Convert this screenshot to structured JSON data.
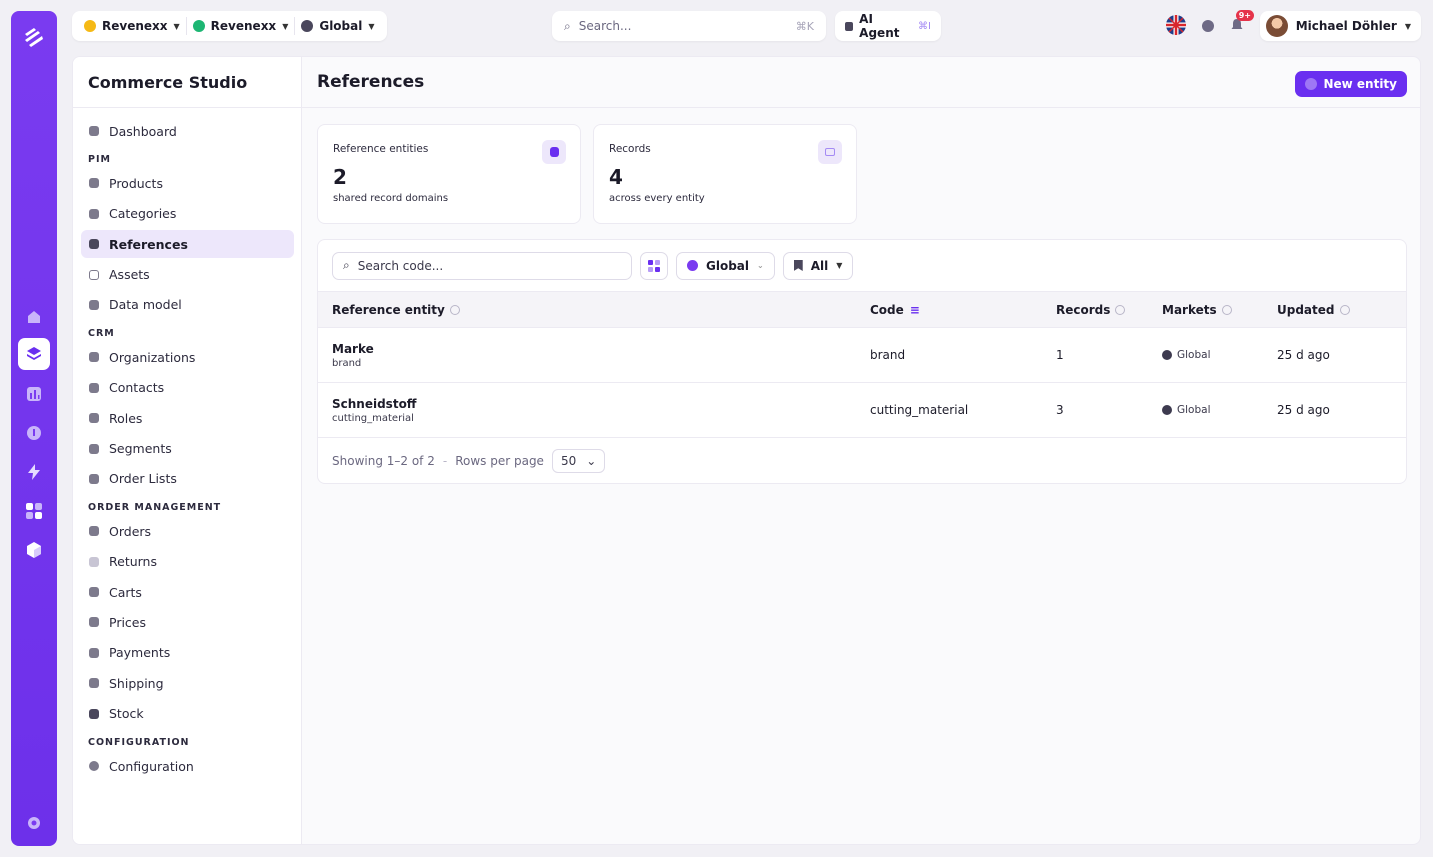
{
  "topbar": {
    "org_select": "Revenexx",
    "tenant_select": "Revenexx",
    "market_select": "Global",
    "search_placeholder": "Search...",
    "search_shortcut": "⌘K",
    "agent_label": "AI Agent",
    "agent_shortcut": "⌘I",
    "notifications_badge": "9+",
    "user_name": "Michael Döhler"
  },
  "sidebar": {
    "title": "Commerce Studio",
    "dashboard": "Dashboard",
    "sections": {
      "pim": "PIM",
      "crm": "CRM",
      "order_management": "ORDER MANAGEMENT",
      "configuration": "CONFIGURATION"
    },
    "pim_items": [
      "Products",
      "Categories",
      "References",
      "Assets",
      "Data model"
    ],
    "crm_items": [
      "Organizations",
      "Contacts",
      "Roles",
      "Segments",
      "Order Lists"
    ],
    "om_items": [
      "Orders",
      "Returns",
      "Carts",
      "Prices",
      "Payments",
      "Shipping",
      "Stock"
    ],
    "config_items": [
      "Configuration"
    ]
  },
  "page": {
    "title": "References",
    "new_button": "New entity"
  },
  "cards": [
    {
      "label": "Reference entities",
      "value": "2",
      "sub": "shared record domains"
    },
    {
      "label": "Records",
      "value": "4",
      "sub": "across every entity"
    }
  ],
  "filters": {
    "search_placeholder": "Search code...",
    "market": "Global",
    "status": "All"
  },
  "table": {
    "columns": [
      "Reference entity",
      "Code",
      "Records",
      "Markets",
      "Updated"
    ],
    "rows": [
      {
        "name": "Marke",
        "code_sub": "brand",
        "code": "brand",
        "records": "1",
        "market": "Global",
        "updated": "25 d ago"
      },
      {
        "name": "Schneidstoff",
        "code_sub": "cutting_material",
        "code": "cutting_material",
        "records": "3",
        "market": "Global",
        "updated": "25 d ago"
      }
    ]
  },
  "pager": {
    "showing": "Showing 1–2 of 2",
    "separator": "-",
    "rows_per_page_label": "Rows per page",
    "rows_per_page": "50"
  },
  "colors": {
    "accent": "#6a2ff0",
    "rail": "#7a3bf0",
    "active_bg": "#ede7fb"
  }
}
